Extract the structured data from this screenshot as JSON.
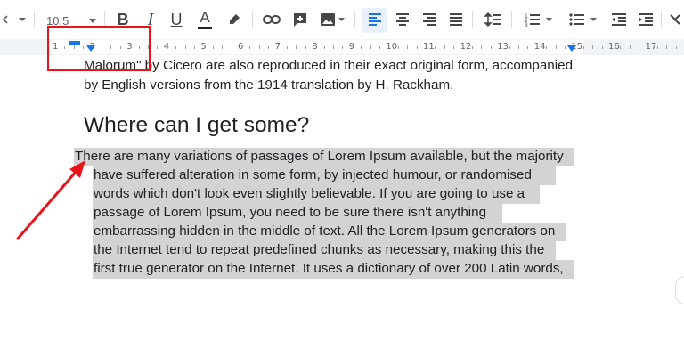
{
  "toolbar": {
    "font_size": "10.5",
    "bold": "B",
    "italic": "I",
    "underline": "U",
    "text_color": "A",
    "active_alignment": "align-left",
    "text_color_hex": "#202124",
    "accent": "#1a73e8"
  },
  "ruler": {
    "numbers": [
      "1",
      "2",
      "3",
      "4",
      "5",
      "6",
      "7",
      "8",
      "9",
      "10",
      "11",
      "12",
      "13",
      "14",
      "15",
      "16",
      "17"
    ]
  },
  "document": {
    "prev_lines": [
      "Malorum\" by Cicero are also reproduced in their exact original form, accompanied",
      "by English versions from the 1914 translation by H. Rackham."
    ],
    "heading": "Where can I get some?",
    "selected_lines": [
      "There are many variations of passages of Lorem Ipsum available, but the majority",
      "have suffered alteration in some form, by injected humour, or randomised",
      "words which don't look even slightly believable. If you are going to use a",
      "passage of Lorem Ipsum, you need to be sure there isn't anything",
      "embarrassing hidden in the middle of text. All the Lorem Ipsum generators on",
      "the Internet tend to repeat predefined chunks as necessary, making this the",
      "first true generator on the Internet. It uses a dictionary of over 200 Latin words,"
    ],
    "selection_color": "#d3d3d3"
  },
  "annotation": {
    "color": "#e8141b"
  }
}
